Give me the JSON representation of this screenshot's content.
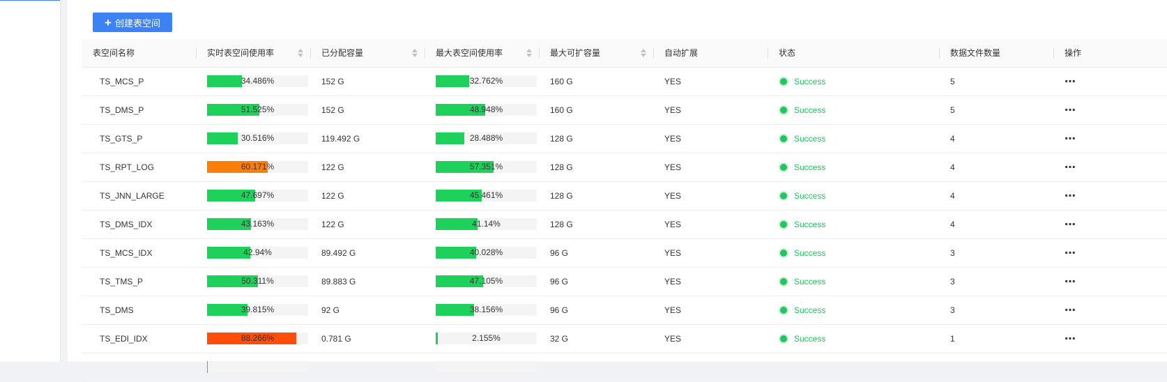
{
  "toolbar": {
    "create_label": "创建表空间"
  },
  "table": {
    "columns": [
      {
        "label": "表空间名称",
        "sortable": false
      },
      {
        "label": "实时表空间使用率",
        "sortable": true
      },
      {
        "label": "已分配容量",
        "sortable": true
      },
      {
        "label": "最大表空间使用率",
        "sortable": true
      },
      {
        "label": "最大可扩容量",
        "sortable": true
      },
      {
        "label": "自动扩展",
        "sortable": false
      },
      {
        "label": "状态",
        "sortable": false
      },
      {
        "label": "数据文件数量",
        "sortable": false
      },
      {
        "label": "操作",
        "sortable": false
      }
    ],
    "rows": [
      {
        "name": "TS_MCS_P",
        "rt_pct": 34.486,
        "rt_label": "34.486%",
        "rt_color": "#1ed15a",
        "allocated": "152 G",
        "max_pct": 32.762,
        "max_label": "32.762%",
        "max_color": "#1ed15a",
        "max_ext": "160 G",
        "auto_ext": "YES",
        "status": "Success",
        "files": "5"
      },
      {
        "name": "TS_DMS_P",
        "rt_pct": 51.525,
        "rt_label": "51.525%",
        "rt_color": "#1ed15a",
        "allocated": "152 G",
        "max_pct": 48.948,
        "max_label": "48.948%",
        "max_color": "#1ed15a",
        "max_ext": "160 G",
        "auto_ext": "YES",
        "status": "Success",
        "files": "5"
      },
      {
        "name": "TS_GTS_P",
        "rt_pct": 30.516,
        "rt_label": "30.516%",
        "rt_color": "#1ed15a",
        "allocated": "119.492 G",
        "max_pct": 28.488,
        "max_label": "28.488%",
        "max_color": "#1ed15a",
        "max_ext": "128 G",
        "auto_ext": "YES",
        "status": "Success",
        "files": "4"
      },
      {
        "name": "TS_RPT_LOG",
        "rt_pct": 60.171,
        "rt_label": "60.171%",
        "rt_color": "#fa7f0a",
        "allocated": "122 G",
        "max_pct": 57.351,
        "max_label": "57.351%",
        "max_color": "#1ed15a",
        "max_ext": "128 G",
        "auto_ext": "YES",
        "status": "Success",
        "files": "4"
      },
      {
        "name": "TS_JNN_LARGE",
        "rt_pct": 47.697,
        "rt_label": "47.697%",
        "rt_color": "#1ed15a",
        "allocated": "122 G",
        "max_pct": 45.461,
        "max_label": "45.461%",
        "max_color": "#1ed15a",
        "max_ext": "128 G",
        "auto_ext": "YES",
        "status": "Success",
        "files": "4"
      },
      {
        "name": "TS_DMS_IDX",
        "rt_pct": 43.163,
        "rt_label": "43.163%",
        "rt_color": "#1ed15a",
        "allocated": "122 G",
        "max_pct": 41.14,
        "max_label": "41.14%",
        "max_color": "#1ed15a",
        "max_ext": "128 G",
        "auto_ext": "YES",
        "status": "Success",
        "files": "4"
      },
      {
        "name": "TS_MCS_IDX",
        "rt_pct": 42.94,
        "rt_label": "42.94%",
        "rt_color": "#1ed15a",
        "allocated": "89.492 G",
        "max_pct": 40.028,
        "max_label": "40.028%",
        "max_color": "#1ed15a",
        "max_ext": "96 G",
        "auto_ext": "YES",
        "status": "Success",
        "files": "3"
      },
      {
        "name": "TS_TMS_P",
        "rt_pct": 50.311,
        "rt_label": "50.311%",
        "rt_color": "#1ed15a",
        "allocated": "89.883 G",
        "max_pct": 47.105,
        "max_label": "47.105%",
        "max_color": "#1ed15a",
        "max_ext": "96 G",
        "auto_ext": "YES",
        "status": "Success",
        "files": "3"
      },
      {
        "name": "TS_DMS",
        "rt_pct": 39.815,
        "rt_label": "39.815%",
        "rt_color": "#1ed15a",
        "allocated": "92 G",
        "max_pct": 38.156,
        "max_label": "38.156%",
        "max_color": "#1ed15a",
        "max_ext": "96 G",
        "auto_ext": "YES",
        "status": "Success",
        "files": "3"
      },
      {
        "name": "TS_EDI_IDX",
        "rt_pct": 88.266,
        "rt_label": "88.266%",
        "rt_color": "#ff4d0a",
        "allocated": "0.781 G",
        "max_pct": 2.155,
        "max_label": "2.155%",
        "max_color": "#1ed15a",
        "max_ext": "32 G",
        "auto_ext": "YES",
        "status": "Success",
        "files": "1"
      },
      {
        "name": "",
        "rt_pct": 0.5,
        "rt_label": "",
        "rt_color": "#1ed15a",
        "allocated": "",
        "max_pct": 0,
        "max_label": "",
        "max_color": "#1ed15a",
        "max_ext": "",
        "auto_ext": "",
        "status": "",
        "files": ""
      }
    ]
  },
  "icons": {
    "create": "plus-icon",
    "more": "more-icon",
    "sort": "sort-icon",
    "status": "status-dot-icon"
  },
  "colors": {
    "primary": "#3b82f6",
    "success": "#22c55e",
    "warning": "#fa7f0a",
    "danger": "#ff4d0a",
    "bar_track": "#f4f4f4"
  }
}
